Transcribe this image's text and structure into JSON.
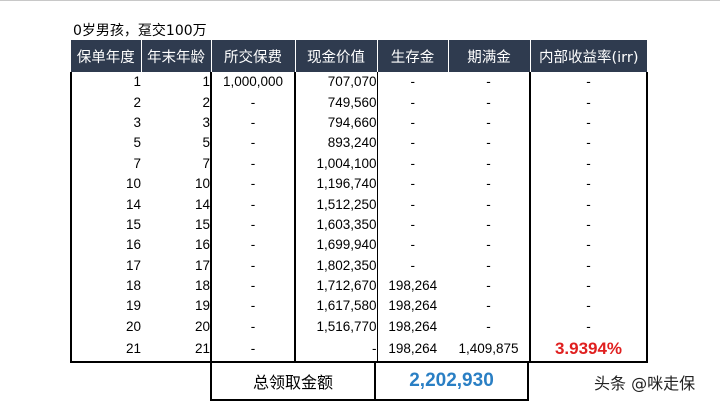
{
  "caption": "0岁男孩，趸交100万",
  "headers": [
    "保单年度",
    "年末年龄",
    "所交保费",
    "现金价值",
    "生存金",
    "期满金",
    "内部收益率(irr)"
  ],
  "rows": [
    [
      "1",
      "1",
      "1,000,000",
      "707,070",
      "-",
      "-",
      "-"
    ],
    [
      "2",
      "2",
      "-",
      "749,560",
      "-",
      "-",
      "-"
    ],
    [
      "3",
      "3",
      "-",
      "794,660",
      "-",
      "-",
      "-"
    ],
    [
      "5",
      "5",
      "-",
      "893,240",
      "-",
      "-",
      "-"
    ],
    [
      "7",
      "7",
      "-",
      "1,004,100",
      "-",
      "-",
      "-"
    ],
    [
      "10",
      "10",
      "-",
      "1,196,740",
      "-",
      "-",
      "-"
    ],
    [
      "14",
      "14",
      "-",
      "1,512,250",
      "-",
      "-",
      "-"
    ],
    [
      "15",
      "15",
      "-",
      "1,603,350",
      "-",
      "-",
      "-"
    ],
    [
      "16",
      "16",
      "-",
      "1,699,940",
      "-",
      "-",
      "-"
    ],
    [
      "17",
      "17",
      "-",
      "1,802,350",
      "-",
      "-",
      "-"
    ],
    [
      "18",
      "18",
      "-",
      "1,712,670",
      "198,264",
      "-",
      "-"
    ],
    [
      "19",
      "19",
      "-",
      "1,617,580",
      "198,264",
      "-",
      "-"
    ],
    [
      "20",
      "20",
      "-",
      "1,516,770",
      "198,264",
      "-",
      "-"
    ],
    [
      "21",
      "21",
      "-",
      "-",
      "198,264",
      "1,409,875",
      "3.9394%"
    ]
  ],
  "total": {
    "label": "总领取金额",
    "value": "2,202,930"
  },
  "watermark": "头条 @咪走保",
  "colors": {
    "header_bg": "#2f3b4f",
    "irr_highlight": "#e02020",
    "total_value": "#2a7fc4"
  }
}
